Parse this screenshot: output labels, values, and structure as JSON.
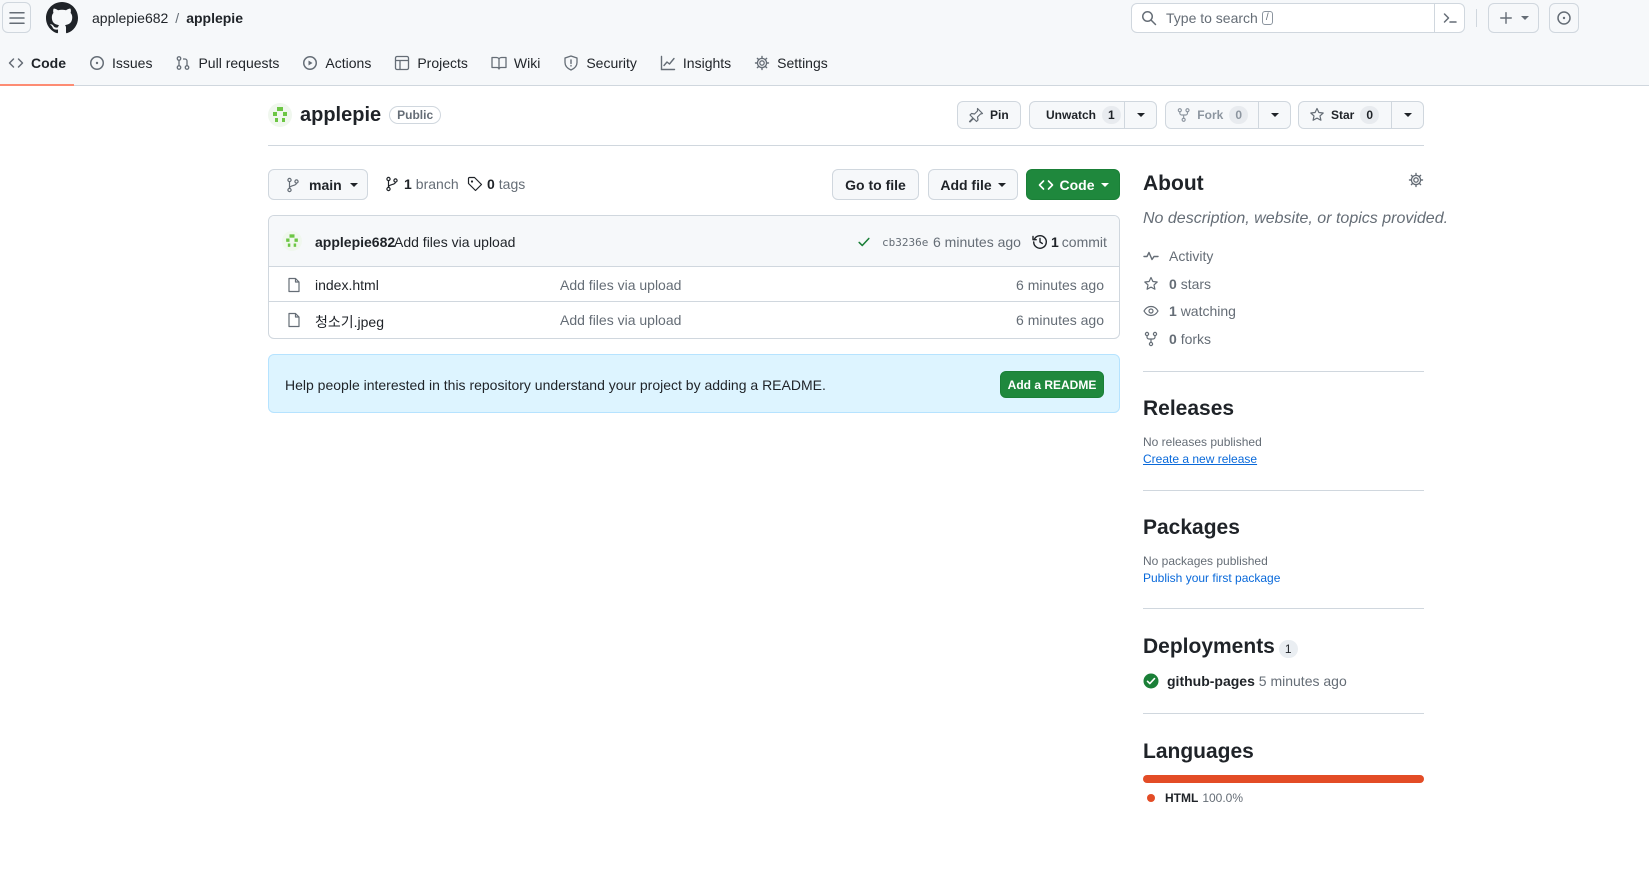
{
  "header": {
    "owner": "applepie682",
    "separator": "/",
    "repo": "applepie",
    "search_placeholder": "Type to search",
    "search_kbd": "/"
  },
  "tabs": [
    {
      "label": "Code",
      "icon": "code-icon",
      "active": true
    },
    {
      "label": "Issues",
      "icon": "issue-icon"
    },
    {
      "label": "Pull requests",
      "icon": "pull-request-icon"
    },
    {
      "label": "Actions",
      "icon": "play-icon"
    },
    {
      "label": "Projects",
      "icon": "table-icon"
    },
    {
      "label": "Wiki",
      "icon": "book-icon"
    },
    {
      "label": "Security",
      "icon": "shield-icon"
    },
    {
      "label": "Insights",
      "icon": "graph-icon"
    },
    {
      "label": "Settings",
      "icon": "gear-icon"
    }
  ],
  "repo_header": {
    "name": "applepie",
    "visibility": "Public",
    "pin_label": "Pin",
    "unwatch_label": "Unwatch",
    "watch_count": "1",
    "fork_label": "Fork",
    "fork_count": "0",
    "star_label": "Star",
    "star_count": "0"
  },
  "toolbar": {
    "branch": "main",
    "branches_count": "1",
    "branches_label": "branch",
    "tags_count": "0",
    "tags_label": "tags",
    "go_to_file": "Go to file",
    "add_file": "Add file",
    "code": "Code"
  },
  "latest_commit": {
    "author": "applepie682",
    "message": "Add files via upload",
    "sha": "cb3236e",
    "time": "6 minutes ago",
    "commit_count": "1",
    "commit_label": "commit"
  },
  "files": [
    {
      "name": "index.html",
      "message": "Add files via upload",
      "age": "6 minutes ago"
    },
    {
      "name": "청소기.jpeg",
      "message": "Add files via upload",
      "age": "6 minutes ago"
    }
  ],
  "readme_prompt": {
    "text": "Help people interested in this repository understand your project by adding a README.",
    "button": "Add a README"
  },
  "about": {
    "title": "About",
    "description": "No description, website, or topics provided.",
    "activity": "Activity",
    "stars_count": "0",
    "stars_label": "stars",
    "watching_count": "1",
    "watching_label": "watching",
    "forks_count": "0",
    "forks_label": "forks"
  },
  "releases": {
    "title": "Releases",
    "empty": "No releases published",
    "link": "Create a new release"
  },
  "packages": {
    "title": "Packages",
    "empty": "No packages published",
    "link": "Publish your first package"
  },
  "deployments": {
    "title": "Deployments",
    "count": "1",
    "env": "github-pages",
    "time": "5 minutes ago"
  },
  "languages": {
    "title": "Languages",
    "items": [
      {
        "name": "HTML",
        "percent": "100.0%",
        "color": "#e34c26"
      }
    ]
  },
  "colors": {
    "accent_green": "#1f883d",
    "link_blue": "#0969da",
    "tab_underline": "#fd8c73",
    "html_lang": "#e34c26"
  }
}
